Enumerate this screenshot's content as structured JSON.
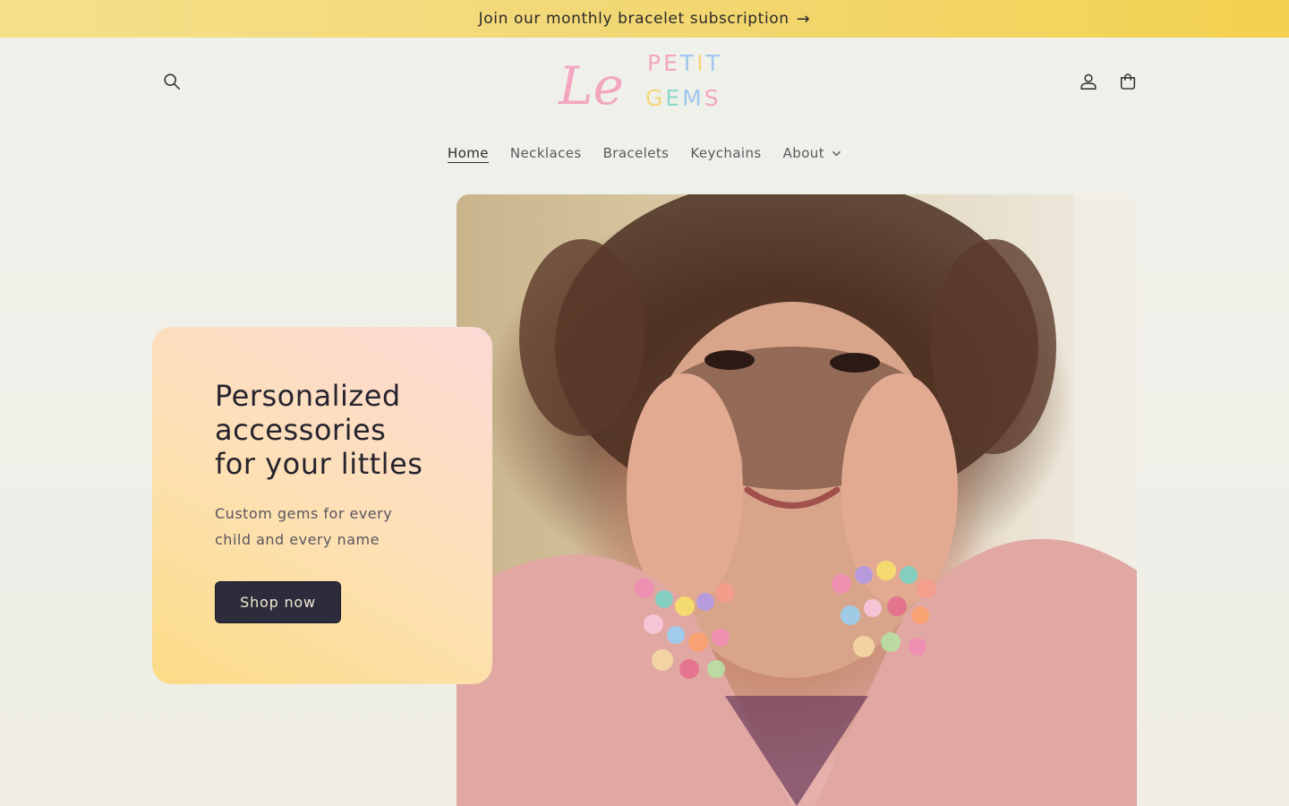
{
  "announcement": {
    "text": "Join our monthly bracelet subscription",
    "arrow": "→"
  },
  "header": {
    "logo": {
      "script_text": "Le",
      "word1": "PETIT",
      "word2": "GEMS"
    },
    "icons": [
      "search-icon",
      "account-icon",
      "cart-icon"
    ]
  },
  "nav": {
    "items": [
      {
        "label": "Home",
        "active": true
      },
      {
        "label": "Necklaces"
      },
      {
        "label": "Bracelets"
      },
      {
        "label": "Keychains"
      },
      {
        "label": "About",
        "has_dropdown": true
      }
    ]
  },
  "hero": {
    "title_lines": [
      "Personalized",
      "accessories",
      "for your littles"
    ],
    "subtitle_lines": [
      "Custom gems for every",
      "child and every name"
    ],
    "button_label": "Shop now",
    "image_alt": "Child with colorful beaded bracelets"
  },
  "colors": {
    "announcement_bg": "#f3d870",
    "page_bg": "#f0f0ea",
    "button_bg": "#2d2c3c",
    "button_text": "#f1ead2",
    "card_gradient_start": "#fbdc86",
    "card_gradient_end": "#fbd9d6",
    "logo_pink": "#f2a6c0",
    "logo_blue": "#9ec6ee",
    "logo_teal": "#8fd8cc",
    "logo_yellow": "#f5d77a"
  }
}
